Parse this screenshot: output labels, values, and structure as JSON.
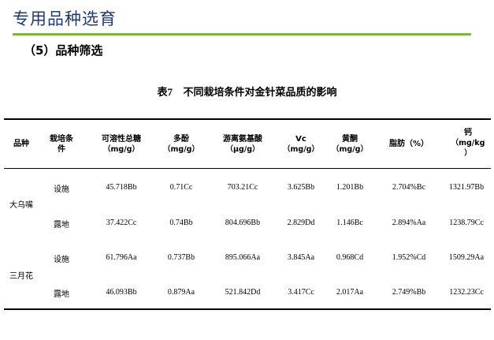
{
  "slide": {
    "title": "专用品种选育",
    "section": "（5）品种筛选"
  },
  "table": {
    "caption_prefix": "表7",
    "caption_text": "不同栽培条件对金针菜品质的影响",
    "headers": [
      {
        "name": "品种",
        "unit": ""
      },
      {
        "name": "栽培条",
        "name2": "件",
        "unit": ""
      },
      {
        "name": "可溶性总糖",
        "unit": "（mg/g）"
      },
      {
        "name": "多酚",
        "unit": "（mg/g）"
      },
      {
        "name": "游离氨基酸",
        "unit": "（μg/g）"
      },
      {
        "name": "Vc",
        "unit": "（mg/g）"
      },
      {
        "name": "黄酮",
        "unit": "（mg/g）"
      },
      {
        "name": "脂肪（%）",
        "unit": ""
      },
      {
        "name": "钙",
        "unit": "（mg/kg",
        "unit2": "）"
      }
    ],
    "groups": [
      {
        "variety": "大乌嘴",
        "rows": [
          {
            "condition": "设施",
            "values": [
              "45.718Bb",
              "0.71Cc",
              "703.21Cc",
              "3.625Bb",
              "1.201Bb",
              "2.704%Bc",
              "1321.97Bb"
            ]
          },
          {
            "condition": "露地",
            "values": [
              "37.422Cc",
              "0.74Bb",
              "804.696Bb",
              "2.829Dd",
              "1.146Bc",
              "2.894%Aa",
              "1238.79Cc"
            ]
          }
        ]
      },
      {
        "variety": "三月花",
        "rows": [
          {
            "condition": "设施",
            "values": [
              "61.796Aa",
              "0.737Bb",
              "895.066Aa",
              "3.845Aa",
              "0.968Cd",
              "1.952%Cd",
              "1509.29Aa"
            ]
          },
          {
            "condition": "露地",
            "values": [
              "46.093Bb",
              "0.879Aa",
              "521.842Dd",
              "3.417Cc",
              "2.017Aa",
              "2.749%Bb",
              "1232.23Cc"
            ]
          }
        ]
      }
    ]
  },
  "colors": {
    "title": "#1f3b73",
    "rule_accent": "#7ab83e"
  }
}
